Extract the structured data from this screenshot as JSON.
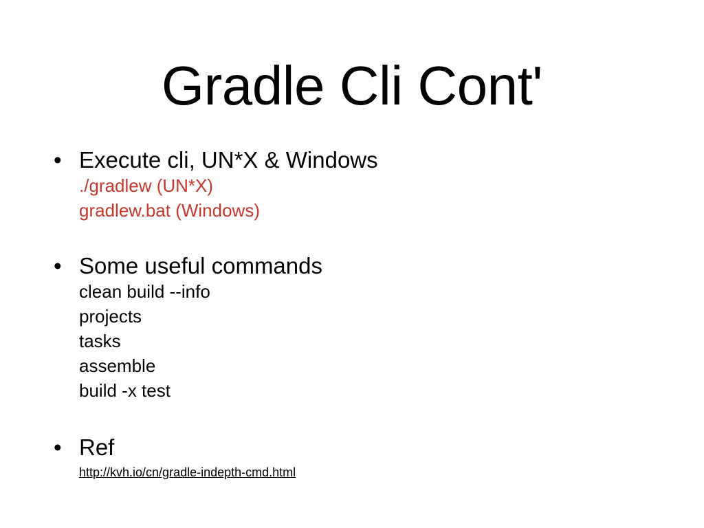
{
  "slide": {
    "title": "Gradle Cli Cont'",
    "bullet_glyph": "•",
    "bullets": [
      {
        "text": "Execute cli, UN*X & Windows",
        "sub_items": [
          "./gradlew (UN*X)",
          "gradlew.bat (Windows)"
        ],
        "sub_color": "#c8372a"
      },
      {
        "text": "Some useful commands",
        "sub_items": [
          "clean build --info",
          "projects",
          "tasks",
          "assemble",
          "build -x test"
        ]
      },
      {
        "text": "Ref",
        "link": "http://kvh.io/cn/gradle-indepth-cmd.html"
      }
    ]
  }
}
